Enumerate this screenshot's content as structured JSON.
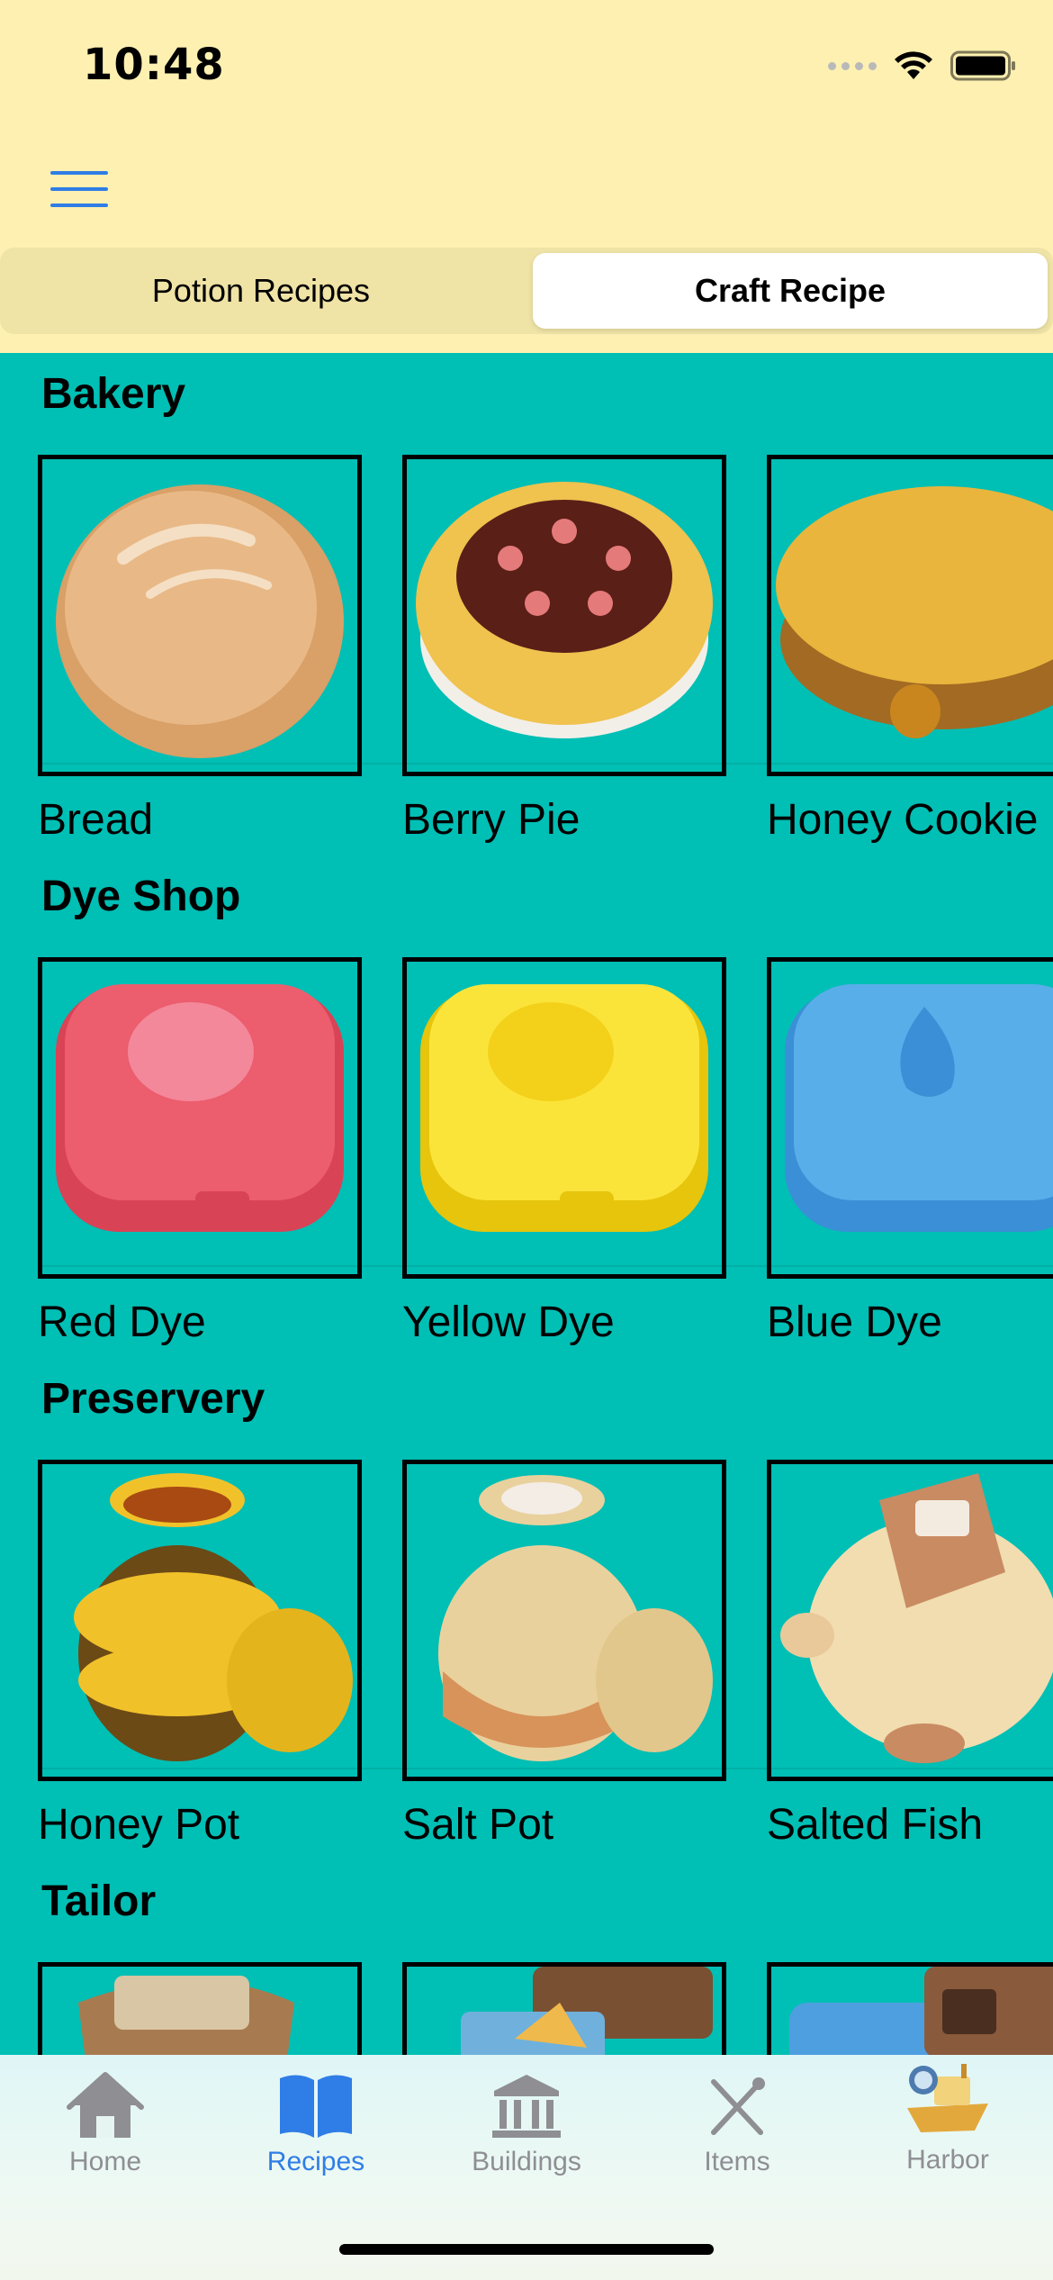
{
  "status_bar": {
    "time": "10:48"
  },
  "header": {
    "menu_icon": "hamburger-icon"
  },
  "segmented": {
    "left_label": "Potion Recipes",
    "right_label": "Craft Recipe",
    "selected": "Craft Recipe"
  },
  "sections": [
    {
      "title": "Bakery",
      "items": [
        {
          "label": "Bread",
          "icon": "bread"
        },
        {
          "label": "Berry Pie",
          "icon": "berry-pie"
        },
        {
          "label": "Honey Cookie",
          "icon": "honey-cookie"
        }
      ]
    },
    {
      "title": "Dye Shop",
      "items": [
        {
          "label": "Red Dye",
          "icon": "red-dye"
        },
        {
          "label": "Yellow Dye",
          "icon": "yellow-dye"
        },
        {
          "label": "Blue Dye",
          "icon": "blue-dye"
        }
      ]
    },
    {
      "title": "Preservery",
      "items": [
        {
          "label": "Honey Pot",
          "icon": "honey-pot"
        },
        {
          "label": "Salt Pot",
          "icon": "salt-pot"
        },
        {
          "label": "Salted Fish",
          "icon": "salted-fish"
        }
      ]
    },
    {
      "title": "Tailor",
      "items": [
        {
          "label": "",
          "icon": "tailor-item-1"
        },
        {
          "label": "",
          "icon": "tailor-item-2"
        },
        {
          "label": "",
          "icon": "tailor-item-3"
        }
      ]
    }
  ],
  "tabbar": {
    "tabs": [
      {
        "label": "Home",
        "icon": "house-icon"
      },
      {
        "label": "Recipes",
        "icon": "book-icon"
      },
      {
        "label": "Buildings",
        "icon": "bank-icon"
      },
      {
        "label": "Items",
        "icon": "crossed-tools-icon"
      },
      {
        "label": "Harbor",
        "icon": "boat-icon"
      }
    ],
    "selected": "Recipes"
  },
  "colors": {
    "accent": "#2f7de6",
    "background": "#00bfb5",
    "header": "#fdf0b1",
    "inactive_tab": "#8e8e93"
  }
}
